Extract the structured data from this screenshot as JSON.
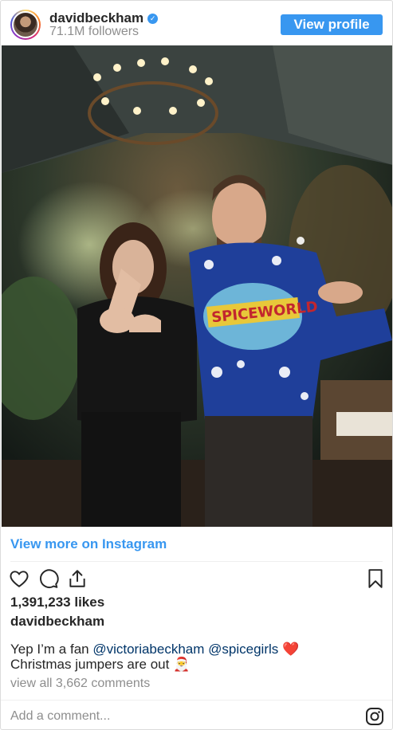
{
  "header": {
    "username": "davidbeckham",
    "verified_mark": "✓",
    "followers": "71.1M followers",
    "view_profile_label": "View profile",
    "accent_color": "#3897f0"
  },
  "photo": {
    "jumper_text": "SPICEWORLD"
  },
  "links": {
    "view_more": "View more on Instagram"
  },
  "actions": {
    "icons": [
      "heart-icon",
      "comment-icon",
      "share-icon",
      "bookmark-icon"
    ]
  },
  "post": {
    "likes": "1,391,233 likes",
    "author": "davidbeckham",
    "caption_prefix": "Yep I’m a fan ",
    "mention_1": "@victoriabeckham",
    "mention_2": "@spicegirls",
    "heart": "❤️",
    "caption_line2": "Christmas jumpers are out",
    "santa": "🎅",
    "view_comments": "view all 3,662 comments"
  },
  "comment_box": {
    "placeholder": "Add a comment...",
    "icon": "instagram-logo-icon"
  }
}
